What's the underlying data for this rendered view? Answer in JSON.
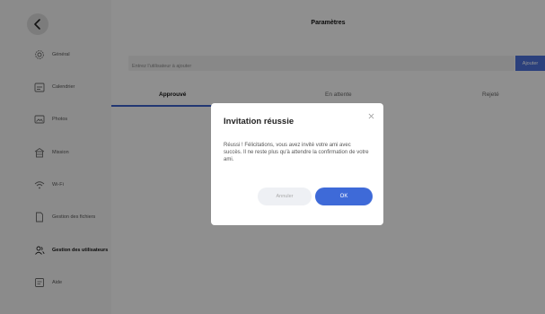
{
  "header": {
    "title": "Paramètres"
  },
  "sidebar": {
    "items": [
      {
        "label": "Général",
        "icon": "gear-icon"
      },
      {
        "label": "Calendrier",
        "icon": "calendar-icon"
      },
      {
        "label": "Photos",
        "icon": "photo-icon"
      },
      {
        "label": "Mission",
        "icon": "mission-icon"
      },
      {
        "label": "Wi-Fi",
        "icon": "wifi-icon"
      },
      {
        "label": "Gestion des fichiers",
        "icon": "file-icon"
      },
      {
        "label": "Gestion des utilisateurs",
        "icon": "users-icon"
      },
      {
        "label": "Aide",
        "icon": "help-icon"
      }
    ]
  },
  "search": {
    "placeholder": "Entrez l'utilisateur à ajouter",
    "button_label": "Ajouter"
  },
  "tabs": [
    {
      "label": "Approuvé"
    },
    {
      "label": "En attente"
    },
    {
      "label": "Rejeté"
    }
  ],
  "dialog": {
    "title": "Invitation réussie",
    "message": "Réussi ! Félicitations, vous avez invité votre ami avec succès. Il ne reste plus qu'à attendre la confirmation de votre ami.",
    "cancel_label": "Annuler",
    "ok_label": "OK"
  },
  "colors": {
    "accent": "#3e6ad8",
    "tab_underline": "#3c5fc7"
  }
}
